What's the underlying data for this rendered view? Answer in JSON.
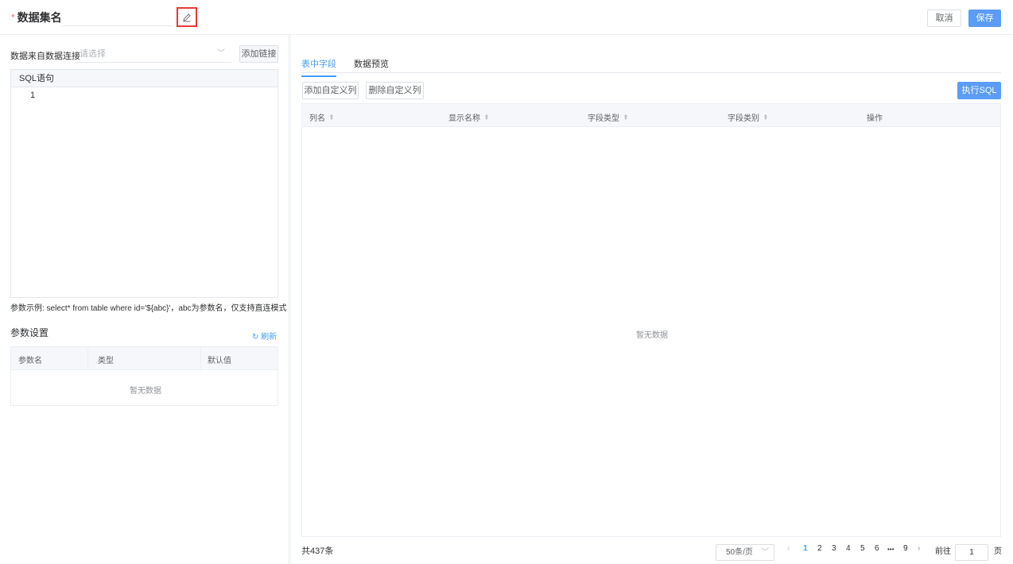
{
  "header": {
    "required_mark": "*",
    "title": "数据集名",
    "cancel_label": "取消",
    "save_label": "保存"
  },
  "left": {
    "source_label": "数据来自数据连接",
    "source_placeholder": "请选择",
    "add_link_label": "添加链接",
    "sql_header": "SQL语句",
    "line_number": "1",
    "hint": "参数示例: select* from table where id='${abc}'，abc为参数名，仅支持直连模式",
    "params_title": "参数设置",
    "refresh_label": "刷新",
    "param_columns": [
      "参数名",
      "类型",
      "默认值"
    ],
    "param_empty": "暂无数据"
  },
  "right": {
    "tabs": [
      {
        "label": "表中字段",
        "active": true
      },
      {
        "label": "数据预览",
        "active": false
      }
    ],
    "add_custom_label": "添加自定义列",
    "delete_custom_label": "删除自定义列",
    "run_sql_label": "执行SQL",
    "columns": [
      "列名",
      "显示名称",
      "字段类型",
      "字段类别",
      "操作"
    ],
    "empty": "暂无数据",
    "total": "共437条",
    "page_size": "50条/页",
    "pages": [
      "1",
      "2",
      "3",
      "4",
      "5",
      "6",
      "•••",
      "9"
    ],
    "current_page": "1",
    "goto_label": "前往",
    "goto_value": "1",
    "page_unit": "页"
  },
  "colors": {
    "primary": "#409eff",
    "required": "#f56c6c",
    "highlight_box": "#e53935"
  },
  "icons": {
    "edit": "pencil-icon",
    "refresh": "refresh-icon",
    "sort": "sort-caret-icon"
  }
}
